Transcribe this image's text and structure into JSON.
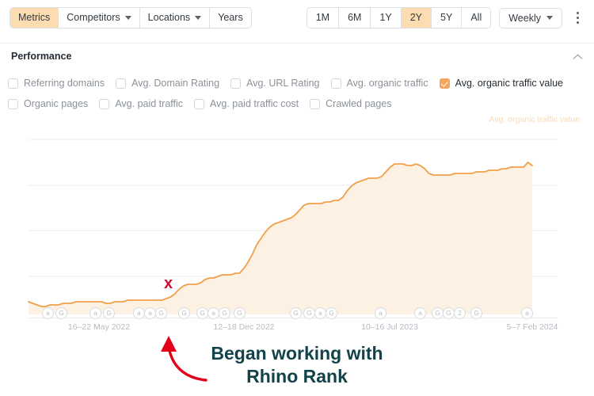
{
  "toolbar": {
    "left_buttons": [
      {
        "label": "Metrics",
        "active": true,
        "caret": false
      },
      {
        "label": "Competitors",
        "active": false,
        "caret": true
      },
      {
        "label": "Locations",
        "active": false,
        "caret": true
      },
      {
        "label": "Years",
        "active": false,
        "caret": false
      }
    ],
    "range_buttons": [
      {
        "label": "1M",
        "active": false
      },
      {
        "label": "6M",
        "active": false
      },
      {
        "label": "1Y",
        "active": false
      },
      {
        "label": "2Y",
        "active": true
      },
      {
        "label": "5Y",
        "active": false
      },
      {
        "label": "All",
        "active": false
      }
    ],
    "granularity": {
      "label": "Weekly",
      "icon": "chevron-down-icon"
    },
    "more_menu_icon": "kebab-menu-icon",
    "active_color": "#fbddb1"
  },
  "section": {
    "title": "Performance",
    "collapse_icon": "chevron-up-icon"
  },
  "metrics": [
    {
      "label": "Referring domains",
      "checked": false
    },
    {
      "label": "Avg. Domain Rating",
      "checked": false
    },
    {
      "label": "Avg. URL Rating",
      "checked": false
    },
    {
      "label": "Avg. organic traffic",
      "checked": false
    },
    {
      "label": "Avg. organic traffic value",
      "checked": true
    },
    {
      "label": "Organic pages",
      "checked": false
    },
    {
      "label": "Avg. paid traffic",
      "checked": false
    },
    {
      "label": "Avg. paid traffic cost",
      "checked": false
    },
    {
      "label": "Crawled pages",
      "checked": false
    }
  ],
  "chart_data": {
    "type": "area",
    "title": "",
    "series_label": "Avg. organic traffic value",
    "line_color": "#f0a04b",
    "fill_color": "#fdf1e4",
    "grid": true,
    "legend_position": "top-right",
    "xlabel": "",
    "ylabel": "",
    "x_tick_labels": [
      "16–22 May 2022",
      "12–18 Dec 2022",
      "10–16 Jul 2023",
      "5–7 Feb 2024"
    ],
    "x_tick_positions": [
      125,
      308,
      492,
      672
    ],
    "y_gridlines": [
      176,
      234,
      291,
      349
    ],
    "values": [
      8,
      7,
      6,
      5,
      5,
      6,
      6,
      6,
      7,
      7,
      7,
      8,
      8,
      8,
      8,
      8,
      8,
      8,
      7,
      7,
      8,
      8,
      8,
      9,
      9,
      9,
      9,
      9,
      9,
      9,
      9,
      9,
      10,
      11,
      13,
      16,
      18,
      19,
      19,
      19,
      20,
      22,
      23,
      23,
      24,
      25,
      25,
      25,
      26,
      26,
      29,
      33,
      38,
      44,
      48,
      52,
      55,
      57,
      58,
      59,
      60,
      61,
      63,
      66,
      69,
      70,
      70,
      70,
      70,
      71,
      71,
      72,
      72,
      74,
      78,
      81,
      83,
      84,
      85,
      86,
      86,
      86,
      87,
      90,
      93,
      95,
      95,
      95,
      94,
      94,
      95,
      94,
      92,
      89,
      88,
      88,
      88,
      88,
      88,
      89,
      89,
      89,
      89,
      89,
      90,
      90,
      90,
      91,
      91,
      91,
      92,
      92,
      93,
      93,
      93,
      93,
      96,
      94
    ],
    "ylim": [
      0,
      110
    ],
    "annotations": [
      {
        "type": "x-marker",
        "label": "x",
        "color": "#c8102e",
        "x": 214,
        "y": 358
      }
    ]
  },
  "axis_markers": [
    {
      "x": 60,
      "letter": "a",
      "stacked": true
    },
    {
      "x": 77,
      "letter": "G",
      "stacked": false
    },
    {
      "x": 120,
      "letter": "a",
      "stacked": false
    },
    {
      "x": 137,
      "letter": "G",
      "stacked": false
    },
    {
      "x": 175,
      "letter": "a",
      "stacked": false
    },
    {
      "x": 189,
      "letter": "a",
      "stacked": false
    },
    {
      "x": 203,
      "letter": "G",
      "stacked": false
    },
    {
      "x": 232,
      "letter": "G",
      "stacked": false
    },
    {
      "x": 255,
      "letter": "G",
      "stacked": true
    },
    {
      "x": 269,
      "letter": "a",
      "stacked": false
    },
    {
      "x": 283,
      "letter": "G",
      "stacked": false
    },
    {
      "x": 302,
      "letter": "G",
      "stacked": true
    },
    {
      "x": 373,
      "letter": "G",
      "stacked": false
    },
    {
      "x": 390,
      "letter": "G",
      "stacked": false
    },
    {
      "x": 404,
      "letter": "a",
      "stacked": false
    },
    {
      "x": 418,
      "letter": "G",
      "stacked": false
    },
    {
      "x": 480,
      "letter": "a",
      "stacked": false
    },
    {
      "x": 530,
      "letter": "a",
      "stacked": false
    },
    {
      "x": 552,
      "letter": "G",
      "stacked": false
    },
    {
      "x": 566,
      "letter": "G",
      "stacked": false
    },
    {
      "x": 580,
      "letter": "2",
      "stacked": false
    },
    {
      "x": 601,
      "letter": "G",
      "stacked": true
    },
    {
      "x": 665,
      "letter": "a",
      "stacked": false
    }
  ],
  "annotation": {
    "line1": "Began working with",
    "line2": "Rhino Rank",
    "color": "#12434a",
    "arrow_color": "#e3001b",
    "arrow_icon": "curved-arrow-up-icon"
  }
}
